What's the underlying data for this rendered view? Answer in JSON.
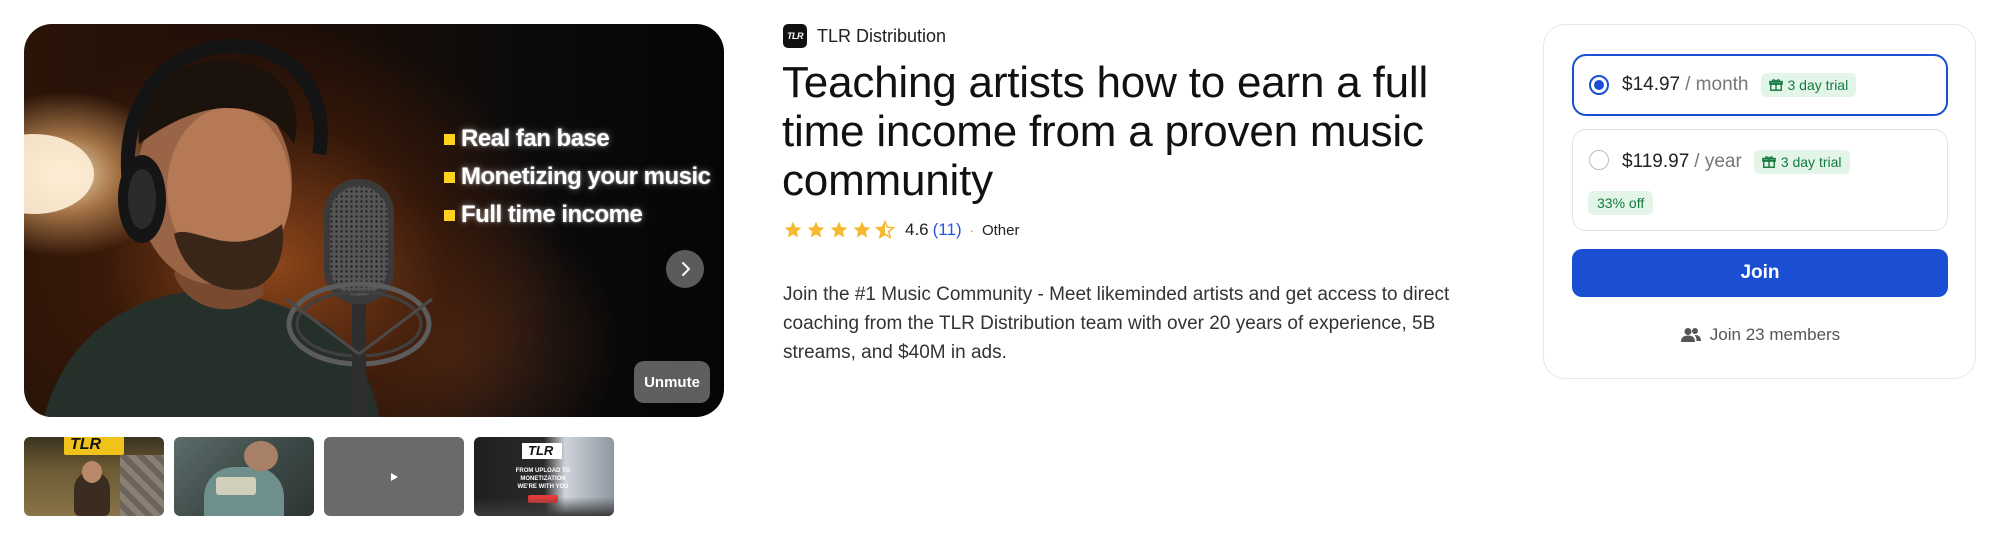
{
  "media": {
    "bullets": [
      "Real fan base",
      "Monetizing your music",
      "Full time income"
    ],
    "unmute_label": "Unmute",
    "thumbnails": [
      {
        "kind": "image",
        "logo_text": "TLR"
      },
      {
        "kind": "image"
      },
      {
        "kind": "video",
        "icon": "play-icon"
      },
      {
        "kind": "image",
        "logo_text": "TLR",
        "caption": "FROM UPLOAD TO MONETIZATION WE'RE WITH YOU"
      }
    ]
  },
  "group": {
    "logo_text": "TLR",
    "name": "TLR Distribution",
    "title": "Teaching artists how to earn a full time income from a proven music community",
    "rating": {
      "value": "4.6",
      "count": "(11)",
      "stars": 4.6
    },
    "separator": "·",
    "category": "Other",
    "description": "Join the #1 Music Community - Meet likeminded artists and get access to direct coaching from the TLR Distribution team with over 20 years of experience, 5B streams, and $40M in ads."
  },
  "pricing": {
    "plans": [
      {
        "price": "$14.97",
        "period": "/ month",
        "trial": "3 day trial",
        "selected": true
      },
      {
        "price": "$119.97",
        "period": "/ year",
        "trial": "3 day trial",
        "discount": "33% off",
        "selected": false
      }
    ],
    "join_label": "Join",
    "members_label": "Join 23 members"
  },
  "colors": {
    "accent": "#1a4fd4",
    "star": "#f5b82e",
    "trial_bg": "#e3f5e9",
    "trial_text": "#137a3e",
    "link": "#2557d6"
  }
}
